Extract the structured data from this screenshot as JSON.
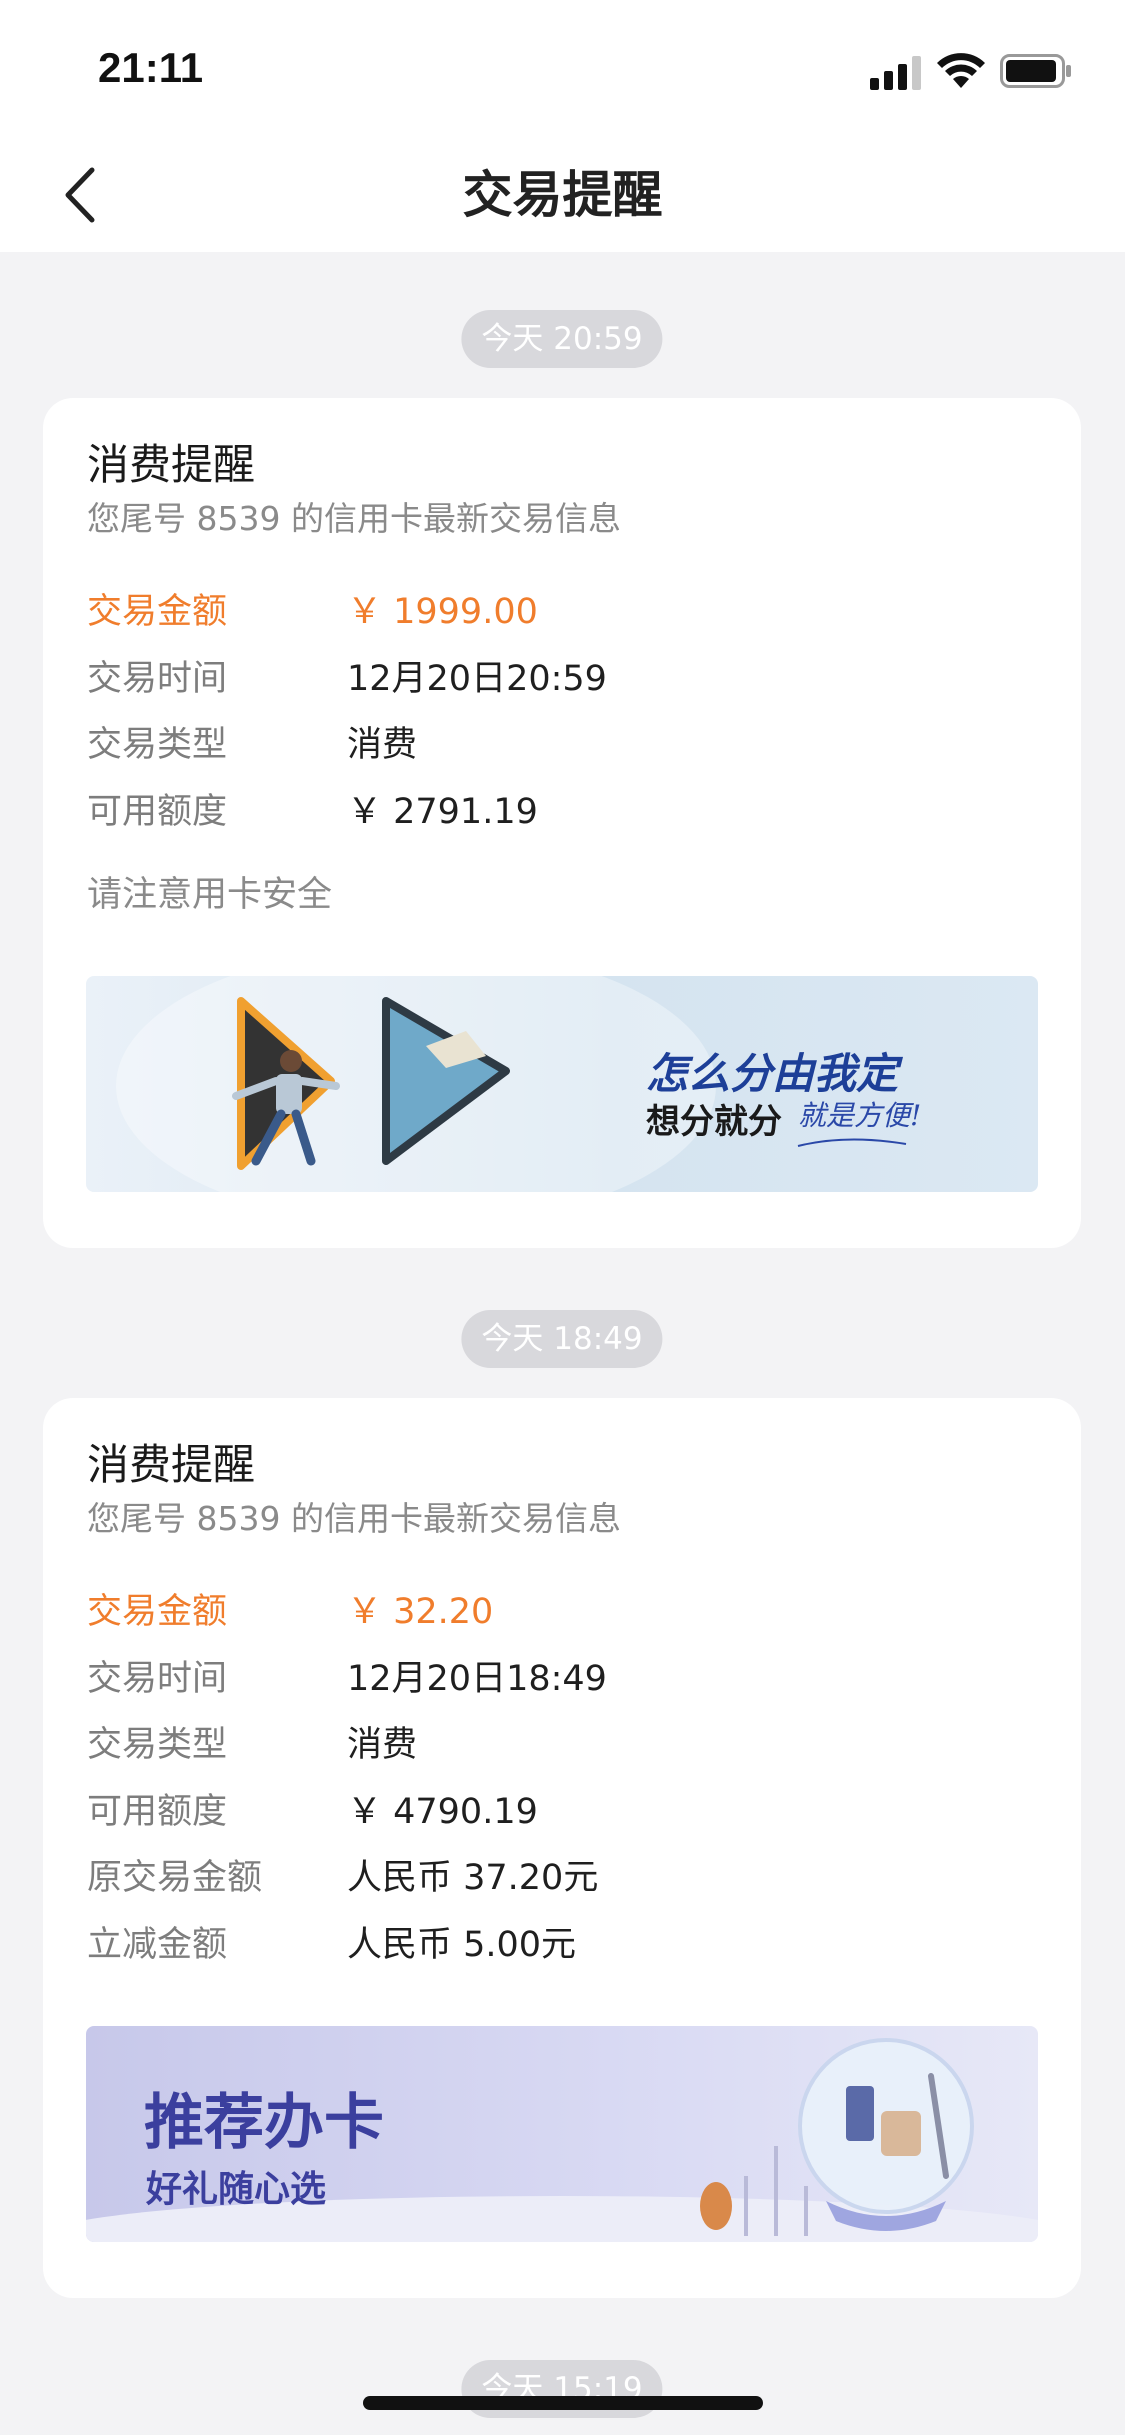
{
  "status_bar": {
    "time": "21:11"
  },
  "nav": {
    "title": "交易提醒"
  },
  "messages": [
    {
      "timestamp": "今天 20:59",
      "title": "消费提醒",
      "subtitle": "您尾号 8539 的信用卡最新交易信息",
      "rows": [
        {
          "label": "交易金额",
          "value": "￥ 1999.00"
        },
        {
          "label": "交易时间",
          "value": "12月20日20:59"
        },
        {
          "label": "交易类型",
          "value": "消费"
        },
        {
          "label": "可用额度",
          "value": "￥ 2791.19"
        }
      ],
      "note": "请注意用卡安全",
      "banner": {
        "line1": "怎么分由我定",
        "line2": "想分就分",
        "slogan": "就是方便!"
      }
    },
    {
      "timestamp": "今天 18:49",
      "title": "消费提醒",
      "subtitle": "您尾号 8539 的信用卡最新交易信息",
      "rows": [
        {
          "label": "交易金额",
          "value": "￥ 32.20"
        },
        {
          "label": "交易时间",
          "value": "12月20日18:49"
        },
        {
          "label": "交易类型",
          "value": "消费"
        },
        {
          "label": "可用额度",
          "value": "￥ 4790.19"
        },
        {
          "label": "原交易金额",
          "value": "人民币 37.20元"
        },
        {
          "label": "立减金额",
          "value": "人民币 5.00元"
        }
      ],
      "banner": {
        "line1": "推荐办卡",
        "line2": "好礼随心选"
      }
    },
    {
      "timestamp": "今天 15:19"
    }
  ],
  "colors": {
    "accent": "#f07d2c",
    "pill": "#d8d8dc",
    "background": "#f3f3f5"
  }
}
